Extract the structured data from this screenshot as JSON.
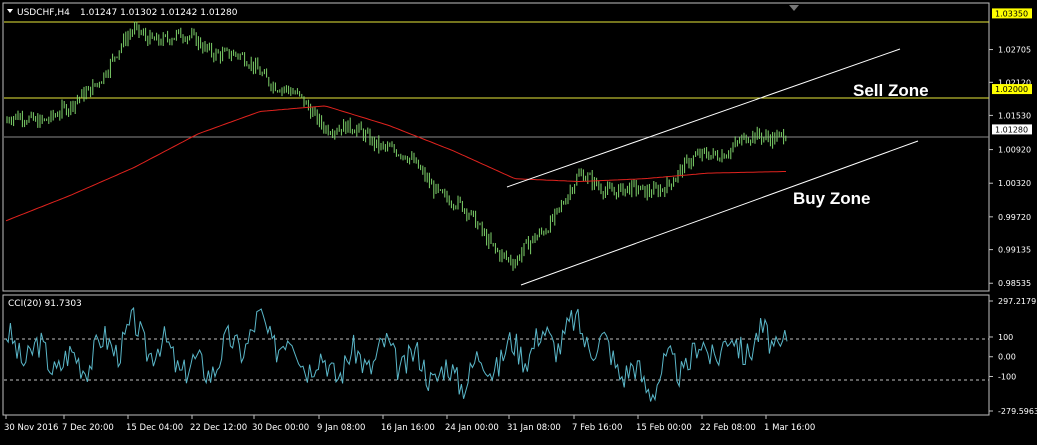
{
  "header": {
    "title": "USDCHF,H4",
    "quote": "1.01247 1.01302 1.01242 1.01280"
  },
  "indicator": {
    "label": "CCI(20) 91.7303"
  },
  "annotations": {
    "sell_zone": "Sell Zone",
    "buy_zone": "Buy Zone"
  },
  "colors": {
    "background": "#000000",
    "candles": "#7fd36b",
    "moving_average": "#e0231e",
    "cci_line": "#5ab7c9",
    "horizontal_levels": "#e8e83a",
    "price_line": "#8a8a8a",
    "channel_lines": "#ffffff",
    "panel_border": "#c0c0c0",
    "label_yellow": "#ffff00"
  },
  "chart_data": [
    {
      "type": "line",
      "title": "USDCHF,H4",
      "symbol": "USDCHF",
      "timeframe": "H4",
      "last_bar": {
        "open": 1.01247,
        "high": 1.01302,
        "low": 1.01242,
        "close": 1.0128
      },
      "x_tick_labels": [
        "30 Nov 2016",
        "7 Dec 20:00",
        "15 Dec 04:00",
        "22 Dec 12:00",
        "30 Dec 00:00",
        "9 Jan 08:00",
        "16 Jan 16:00",
        "24 Jan 00:00",
        "31 Jan 08:00",
        "7 Feb 16:00",
        "15 Feb 00:00",
        "22 Feb 08:00",
        "1 Mar 16:00"
      ],
      "y_tick_labels": [
        "1.02705",
        "1.02120",
        "1.01530",
        "1.00920",
        "1.00320",
        "0.99720",
        "0.99135",
        "0.98535"
      ],
      "ylim": [
        0.9845,
        1.035
      ],
      "grid": false,
      "highlighted_levels": [
        {
          "label": "1.03350",
          "value": 1.0335,
          "style": "yellow-box"
        },
        {
          "label": "1.02000",
          "value": 1.02,
          "style": "yellow-box"
        },
        {
          "label": "1.01280",
          "value": 1.0128,
          "style": "white-box"
        }
      ],
      "close_series": {
        "x": [
          "30 Nov 2016",
          "7 Dec 20:00",
          "15 Dec 04:00",
          "22 Dec 12:00",
          "30 Dec 00:00",
          "9 Jan 08:00",
          "16 Jan 16:00",
          "24 Jan 00:00",
          "31 Jan 08:00",
          "7 Feb 16:00",
          "15 Feb 00:00",
          "22 Feb 08:00",
          "1 Mar 16:00"
        ],
        "values": [
          1.014,
          1.016,
          1.03,
          1.0285,
          1.0235,
          1.014,
          1.01,
          1.0,
          0.9885,
          1.004,
          1.001,
          1.0085,
          1.0128
        ]
      },
      "moving_average": {
        "x": [
          "30 Nov 2016",
          "7 Dec 20:00",
          "15 Dec 04:00",
          "22 Dec 12:00",
          "30 Dec 00:00",
          "9 Jan 08:00",
          "16 Jan 16:00",
          "24 Jan 00:00",
          "31 Jan 08:00",
          "7 Feb 16:00",
          "15 Feb 00:00",
          "22 Feb 08:00",
          "1 Mar 16:00"
        ],
        "values": [
          0.9965,
          1.001,
          1.006,
          1.012,
          1.016,
          1.017,
          1.0135,
          1.009,
          1.004,
          1.0035,
          1.004,
          1.005,
          1.0053
        ]
      },
      "channel_lines": [
        {
          "name": "upper",
          "points": [
            [
              "29 Jan 12:00",
              1.0035
            ],
            [
              "6 Mar 00:00",
              1.0288
            ]
          ]
        },
        {
          "name": "lower",
          "points": [
            [
              "31 Jan 08:00",
              0.987
            ],
            [
              "6 Mar 00:00",
              1.0122
            ]
          ]
        }
      ]
    },
    {
      "type": "line",
      "title": "CCI(20) 91.7303",
      "indicator": "CCI",
      "period": 20,
      "current_value": 91.7303,
      "y_tick_labels": [
        "297.2179",
        "100",
        "0.00",
        "-100",
        "-279.5963"
      ],
      "ylim": [
        -279.5963,
        297.2179
      ],
      "levels": [
        100,
        -100
      ],
      "x": [
        "30 Nov 2016",
        "7 Dec 20:00",
        "15 Dec 04:00",
        "22 Dec 12:00",
        "30 Dec 00:00",
        "9 Jan 08:00",
        "16 Jan 16:00",
        "24 Jan 00:00",
        "31 Jan 08:00",
        "7 Feb 16:00",
        "15 Feb 00:00",
        "22 Feb 08:00",
        "1 Mar 16:00"
      ],
      "values": [
        60,
        -40,
        120,
        -80,
        150,
        -60,
        20,
        -110,
        30,
        140,
        -140,
        40,
        91.7303
      ]
    }
  ]
}
